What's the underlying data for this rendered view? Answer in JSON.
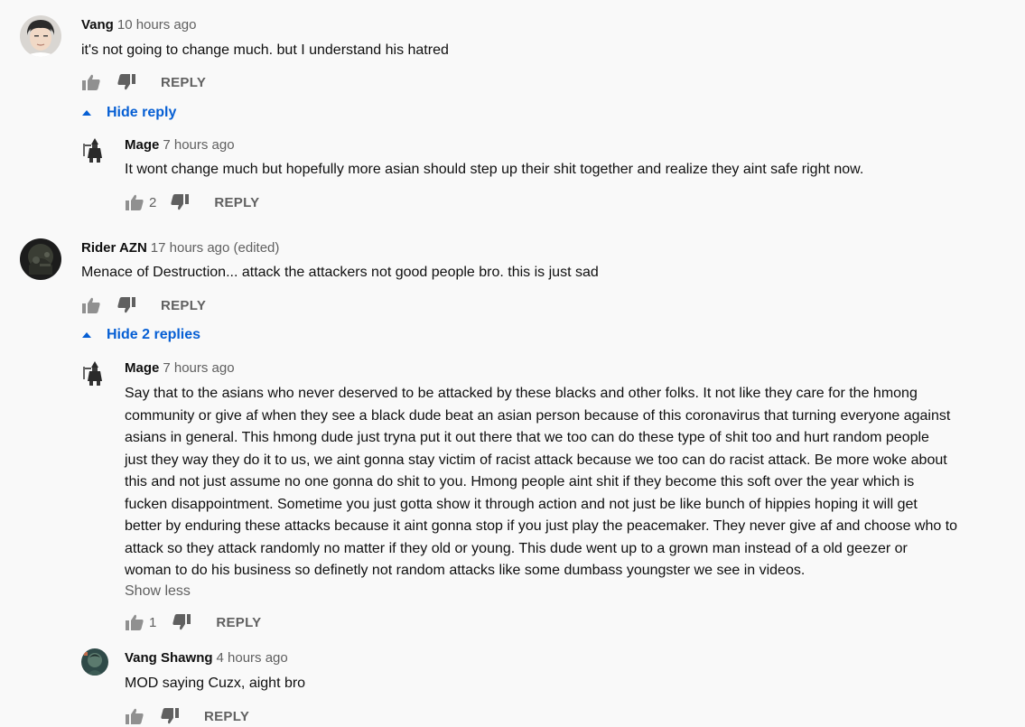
{
  "comments": [
    {
      "author": "Vang",
      "time": "10 hours ago",
      "text": "it's not going to change much. but I understand his hatred",
      "likes": "",
      "reply_label": "REPLY",
      "toggle_label": "Hide reply",
      "replies": [
        {
          "author": "Mage",
          "time": "7 hours ago",
          "text": "It wont change much but hopefully more asian should step up their shit together and realize they aint safe right now.",
          "likes": "2",
          "reply_label": "REPLY"
        }
      ]
    },
    {
      "author": "Rider AZN",
      "time": "17 hours ago (edited)",
      "text": "Menace of Destruction... attack the attackers not good people bro. this is just sad",
      "likes": "",
      "reply_label": "REPLY",
      "toggle_label": "Hide 2 replies",
      "replies": [
        {
          "author": "Mage",
          "time": "7 hours ago",
          "lines": [
            "Say that to the asians who never deserved to be attacked by these blacks and other folks. It not like they care for the hmong",
            "community or give af when they see a black dude beat an asian person because of this coronavirus that turning everyone against",
            "asians in general. This hmong dude just tryna put it out there that we too can do these type of shit too and hurt random people",
            "just they way they do it to us, we aint gonna stay victim of racist attack because we too can do racist attack. Be more woke about",
            "this and not just assume no one gonna do shit to you. Hmong people aint shit if they become this soft over the year which is",
            "fucken disappointment. Sometime you just gotta show it through action and not just be like bunch of hippies hoping it will get",
            "better by enduring these attacks because it aint gonna stop if you just play the peacemaker. They never give af and choose who to",
            "attack so they attack randomly no matter if they old or young. This dude went up to a grown man instead of a old geezer or",
            "woman to do his business so definetly not random attacks like some dumbass youngster we see in videos."
          ],
          "show_less": "Show less",
          "likes": "1",
          "reply_label": "REPLY"
        },
        {
          "author": "Vang Shawng",
          "time": "4 hours ago",
          "text": "MOD saying Cuzx, aight bro",
          "likes": "",
          "reply_label": "REPLY"
        }
      ]
    }
  ],
  "colors": {
    "background": "#f9f9f9",
    "link_blue": "#065fd4",
    "meta_gray": "#606060"
  }
}
